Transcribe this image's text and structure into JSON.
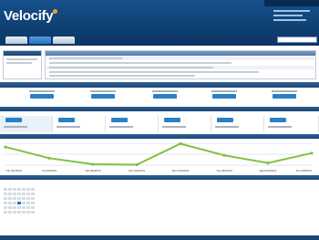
{
  "app": {
    "logo_text": "Velocify"
  },
  "chart_data": {
    "type": "line",
    "x": [
      "Thu 04/18/13",
      "Fri 04/19/13",
      "Sat 04/20/13",
      "Sun 04/21/13",
      "Mon 04/22/13",
      "Tue 04/23/13",
      "Wed 04/24/13",
      "Thu 04/25/13"
    ],
    "y": [
      0.83,
      0.32,
      0.04,
      0.02,
      0.98,
      0.45,
      0.1,
      0.55
    ],
    "ylim": [
      0,
      1
    ],
    "grid": true,
    "color": "#7fc241"
  },
  "calendar": {
    "today_index": 24
  }
}
